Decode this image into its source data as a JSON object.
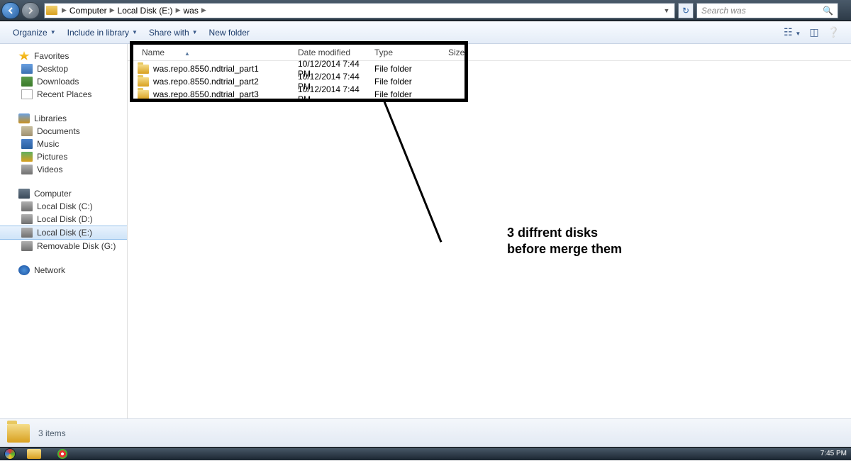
{
  "address": {
    "crumbs": [
      "Computer",
      "Local Disk (E:)",
      "was"
    ],
    "search_placeholder": "Search was"
  },
  "toolbar": {
    "organize": "Organize",
    "include": "Include in library",
    "share": "Share with",
    "newfolder": "New folder"
  },
  "sidebar": {
    "favorites": {
      "label": "Favorites",
      "desktop": "Desktop",
      "downloads": "Downloads",
      "recent": "Recent Places"
    },
    "libraries": {
      "label": "Libraries",
      "docs": "Documents",
      "music": "Music",
      "pics": "Pictures",
      "vids": "Videos"
    },
    "computer": {
      "label": "Computer",
      "c": "Local Disk (C:)",
      "d": "Local Disk (D:)",
      "e": "Local Disk (E:)",
      "g": "Removable Disk (G:)"
    },
    "network": {
      "label": "Network"
    }
  },
  "columns": {
    "name": "Name",
    "date": "Date modified",
    "type": "Type",
    "size": "Size"
  },
  "files": [
    {
      "name": "was.repo.8550.ndtrial_part1",
      "date": "10/12/2014 7:44 PM",
      "type": "File folder",
      "size": ""
    },
    {
      "name": "was.repo.8550.ndtrial_part2",
      "date": "10/12/2014 7:44 PM",
      "type": "File folder",
      "size": ""
    },
    {
      "name": "was.repo.8550.ndtrial_part3",
      "date": "10/12/2014 7:44 PM",
      "type": "File folder",
      "size": ""
    }
  ],
  "annotation": {
    "line1": "3 diffrent disks",
    "line2": "before merge them"
  },
  "status": {
    "text": "3 items"
  },
  "taskbar": {
    "time": "7:45 PM"
  }
}
